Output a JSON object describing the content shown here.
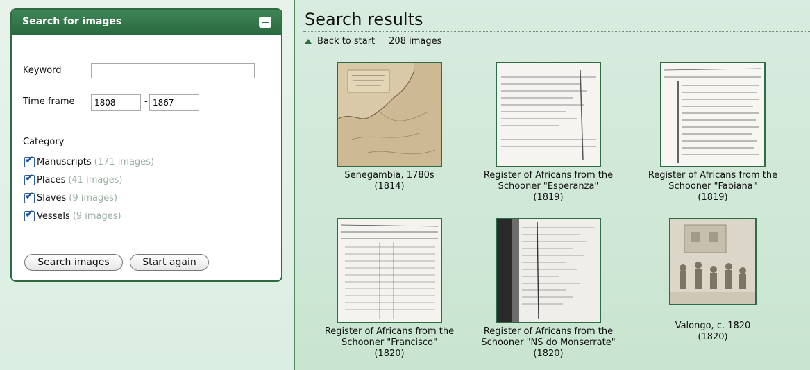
{
  "search_panel": {
    "title": "Search for images",
    "keyword_label": "Keyword",
    "keyword_value": "",
    "timeframe_label": "Time frame",
    "year_from": "1808",
    "year_dash": "-",
    "year_to": "1867",
    "category_label": "Category",
    "categories": [
      {
        "label": "Manuscripts",
        "count": "(171 images)",
        "checked": true
      },
      {
        "label": "Places",
        "count": "(41 images)",
        "checked": true
      },
      {
        "label": "Slaves",
        "count": "(9 images)",
        "checked": true
      },
      {
        "label": "Vessels",
        "count": "(9 images)",
        "checked": true
      }
    ],
    "search_button": "Search images",
    "restart_button": "Start again"
  },
  "results": {
    "title": "Search results",
    "back_label": "Back to start",
    "count_label": "208 images",
    "items": [
      {
        "line1": "Senegambia, 1780s",
        "line2": "(1814)",
        "line3": "",
        "image": "map"
      },
      {
        "line1": "Register of Africans from the",
        "line2": "Schooner \"Esperanza\"",
        "line3": "(1819)",
        "image": "manuscript"
      },
      {
        "line1": "Register of Africans from the",
        "line2": "Schooner \"Fabiana\"",
        "line3": "(1819)",
        "image": "manuscript"
      },
      {
        "line1": "Register of Africans from the",
        "line2": "Schooner \"Francisco\"",
        "line3": "(1820)",
        "image": "manuscript"
      },
      {
        "line1": "Register of Africans from the",
        "line2": "Schooner \"NS do Monserrate\"",
        "line3": "(1820)",
        "image": "manuscript"
      },
      {
        "line1": "Valongo, c. 1820",
        "line2": "(1820)",
        "line3": "",
        "image": "engraving"
      }
    ]
  }
}
